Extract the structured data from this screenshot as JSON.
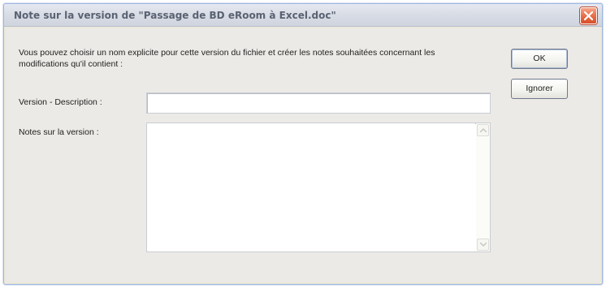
{
  "dialog": {
    "title": "Note sur la version de \"Passage de BD eRoom à Excel.doc\"",
    "intro": "Vous pouvez choisir un nom explicite pour cette version du fichier et créer les notes souhaitées concernant les modifications qu'il contient :",
    "description_label": "Version - Description :",
    "description_value": "",
    "notes_label": "Notes sur la version :",
    "notes_value": "",
    "ok_label": "OK",
    "ignore_label": "Ignorer",
    "close_icon": "close-icon"
  },
  "colors": {
    "close_button": "#e86a43",
    "dialog_background": "#eceae6"
  }
}
